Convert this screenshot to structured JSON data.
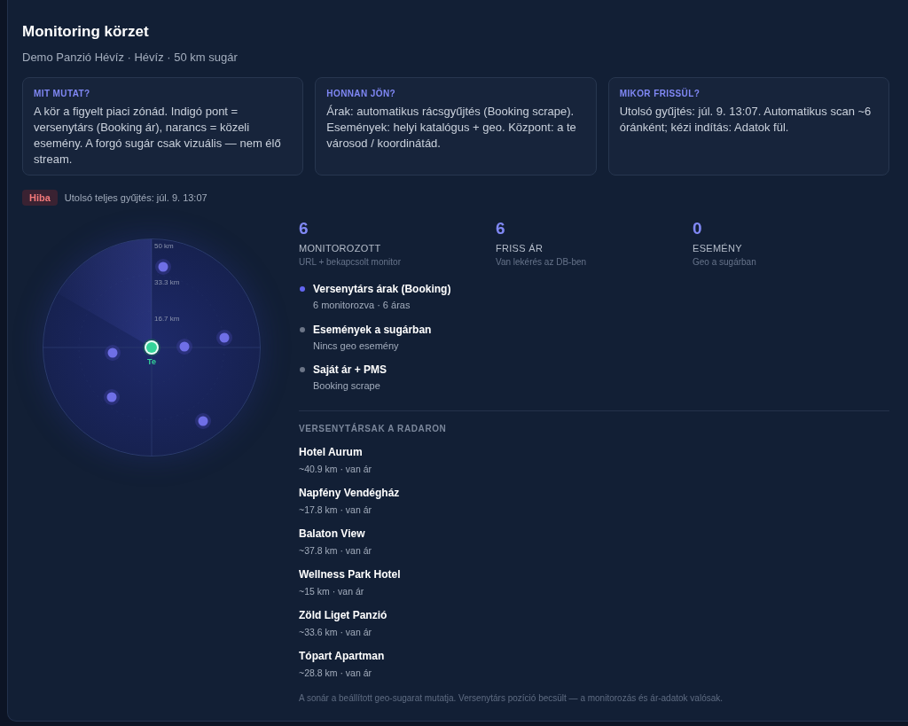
{
  "header": {
    "title": "Monitoring körzet",
    "subtitle": "Demo Panzió Hévíz · Hévíz · 50 km sugár"
  },
  "info_cards": [
    {
      "heading": "MIT MUTAT?",
      "text": "A kör a figyelt piaci zónád. Indigó pont = versenytárs (Booking ár), narancs = közeli esemény. A forgó sugár csak vizuális — nem élő stream."
    },
    {
      "heading": "HONNAN JÖN?",
      "text": "Árak: automatikus rácsgyűjtés (Booking scrape). Események: helyi katalógus + geo. Központ: a te városod / koordinátád."
    },
    {
      "heading": "MIKOR FRISSÜL?",
      "text": "Utolsó gyűjtés: júl. 9. 13:07. Automatikus scan ~6 óránként; kézi indítás: Adatok fül."
    }
  ],
  "status": {
    "badge": "Hiba",
    "text": "Utolsó teljes gyűjtés: júl. 9. 13:07"
  },
  "radar": {
    "ring_labels": [
      "50 km",
      "33.3 km",
      "16.7 km"
    ],
    "center_label": "Te"
  },
  "stats": [
    {
      "value": "6",
      "label": "MONITOROZOTT",
      "caption": "URL + bekapcsolt monitor"
    },
    {
      "value": "6",
      "label": "FRISS ÁR",
      "caption": "Van lekérés az DB-ben"
    },
    {
      "value": "0",
      "label": "ESEMÉNY",
      "caption": "Geo a sugárban"
    }
  ],
  "sources": [
    {
      "title": "Versenytárs árak (Booking)",
      "caption": "6 monitorozva · 6 áras",
      "color": "#6366f1"
    },
    {
      "title": "Események a sugárban",
      "caption": "Nincs geo esemény",
      "color": "#6b7587"
    },
    {
      "title": "Saját ár + PMS",
      "caption": "Booking scrape",
      "color": "#6b7587"
    }
  ],
  "competitors": {
    "heading": "VERSENYTÁRSAK A RADARON",
    "items": [
      {
        "name": "Hotel Aurum",
        "caption": "~40.9 km · van ár"
      },
      {
        "name": "Napfény Vendégház",
        "caption": "~17.8 km · van ár"
      },
      {
        "name": "Balaton View",
        "caption": "~37.8 km · van ár"
      },
      {
        "name": "Wellness Park Hotel",
        "caption": "~15 km · van ár"
      },
      {
        "name": "Zöld Liget Panzió",
        "caption": "~33.6 km · van ár"
      },
      {
        "name": "Tópart Apartman",
        "caption": "~28.8 km · van ár"
      }
    ]
  },
  "footnote": "A sonár a beállított geo-sugarat mutatja. Versenytárs pozíció becsült — a monitorozás és ár-adatok valósak."
}
